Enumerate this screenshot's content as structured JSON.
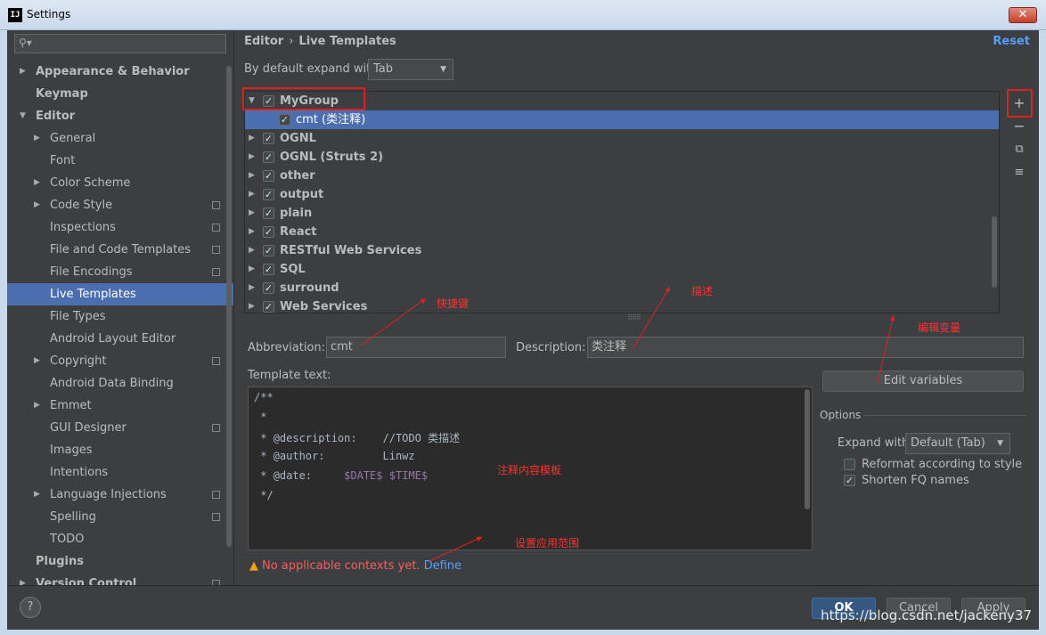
{
  "window": {
    "title": "Settings",
    "app_icon": "IJ"
  },
  "search": {
    "placeholder": ""
  },
  "sidebar": {
    "items": [
      {
        "label": "Appearance & Behavior",
        "bold": true,
        "arrow": "right",
        "level": 0
      },
      {
        "label": "Keymap",
        "bold": true,
        "arrow": "none",
        "level": 0
      },
      {
        "label": "Editor",
        "bold": true,
        "arrow": "down",
        "level": 0
      },
      {
        "label": "General",
        "arrow": "right",
        "level": 1
      },
      {
        "label": "Font",
        "arrow": "none",
        "level": 1
      },
      {
        "label": "Color Scheme",
        "arrow": "right",
        "level": 1
      },
      {
        "label": "Code Style",
        "arrow": "right",
        "level": 1,
        "project_icon": true
      },
      {
        "label": "Inspections",
        "arrow": "none",
        "level": 1,
        "project_icon": true
      },
      {
        "label": "File and Code Templates",
        "arrow": "none",
        "level": 1,
        "project_icon": true
      },
      {
        "label": "File Encodings",
        "arrow": "none",
        "level": 1,
        "project_icon": true
      },
      {
        "label": "Live Templates",
        "arrow": "none",
        "level": 1,
        "selected": true
      },
      {
        "label": "File Types",
        "arrow": "none",
        "level": 1
      },
      {
        "label": "Android Layout Editor",
        "arrow": "none",
        "level": 1
      },
      {
        "label": "Copyright",
        "arrow": "right",
        "level": 1,
        "project_icon": true
      },
      {
        "label": "Android Data Binding",
        "arrow": "none",
        "level": 1
      },
      {
        "label": "Emmet",
        "arrow": "right",
        "level": 1
      },
      {
        "label": "GUI Designer",
        "arrow": "none",
        "level": 1,
        "project_icon": true
      },
      {
        "label": "Images",
        "arrow": "none",
        "level": 1
      },
      {
        "label": "Intentions",
        "arrow": "none",
        "level": 1
      },
      {
        "label": "Language Injections",
        "arrow": "right",
        "level": 1,
        "project_icon": true
      },
      {
        "label": "Spelling",
        "arrow": "none",
        "level": 1,
        "project_icon": true
      },
      {
        "label": "TODO",
        "arrow": "none",
        "level": 1
      },
      {
        "label": "Plugins",
        "bold": true,
        "arrow": "none",
        "level": 0
      },
      {
        "label": "Version Control",
        "bold": true,
        "arrow": "right",
        "level": 0,
        "project_icon": true
      }
    ]
  },
  "breadcrumb": {
    "parent": "Editor",
    "separator": "›",
    "current": "Live Templates"
  },
  "reset_label": "Reset",
  "expand_default": {
    "label": "By default expand with",
    "value": "Tab"
  },
  "template_groups": [
    {
      "label": "MyGroup",
      "expanded": true,
      "checked": true
    },
    {
      "label": "cmt (类注释)",
      "child": true,
      "checked": true,
      "selected": true
    },
    {
      "label": "OGNL",
      "checked": true
    },
    {
      "label": "OGNL (Struts 2)",
      "checked": true
    },
    {
      "label": "other",
      "checked": true
    },
    {
      "label": "output",
      "checked": true
    },
    {
      "label": "plain",
      "checked": true
    },
    {
      "label": "React",
      "checked": true
    },
    {
      "label": "RESTful Web Services",
      "checked": true
    },
    {
      "label": "SQL",
      "checked": true
    },
    {
      "label": "surround",
      "checked": true
    },
    {
      "label": "Web Services",
      "checked": true
    }
  ],
  "tools": {
    "add": "+",
    "remove": "−",
    "copy": "⧉",
    "template": "≡"
  },
  "annotations": {
    "shortcut": "快捷键",
    "description": "描述",
    "edit_vars": "编辑变量",
    "template_content": "注释内容模板",
    "scope": "设置应用范围"
  },
  "abbreviation": {
    "label": "Abbreviation:",
    "value": "cmt"
  },
  "description": {
    "label": "Description:",
    "value": "类注释"
  },
  "template_text": {
    "label": "Template text:",
    "lines": [
      {
        "text": "/**",
        "var": ""
      },
      {
        "text": " *",
        "var": ""
      },
      {
        "text": " * @description:    //TODO 类描述",
        "var": ""
      },
      {
        "text": " * @author:         Linwz",
        "var": ""
      },
      {
        "text": " * @date:     ",
        "var": "$DATE$ $TIME$"
      },
      {
        "text": " */",
        "var": ""
      }
    ]
  },
  "edit_variables_label": "Edit variables",
  "options": {
    "title": "Options",
    "expand_with": {
      "label": "Expand with",
      "value": "Default (Tab)"
    },
    "reformat": {
      "label": "Reformat according to style",
      "checked": false
    },
    "shorten": {
      "label": "Shorten FQ names",
      "checked": true
    }
  },
  "warning": {
    "text": "No applicable contexts yet.",
    "link": "Define"
  },
  "footer": {
    "help": "?",
    "ok": "OK",
    "cancel": "Cancel",
    "apply": "Apply"
  },
  "watermark": "https://blog.csdn.net/jackeny37"
}
